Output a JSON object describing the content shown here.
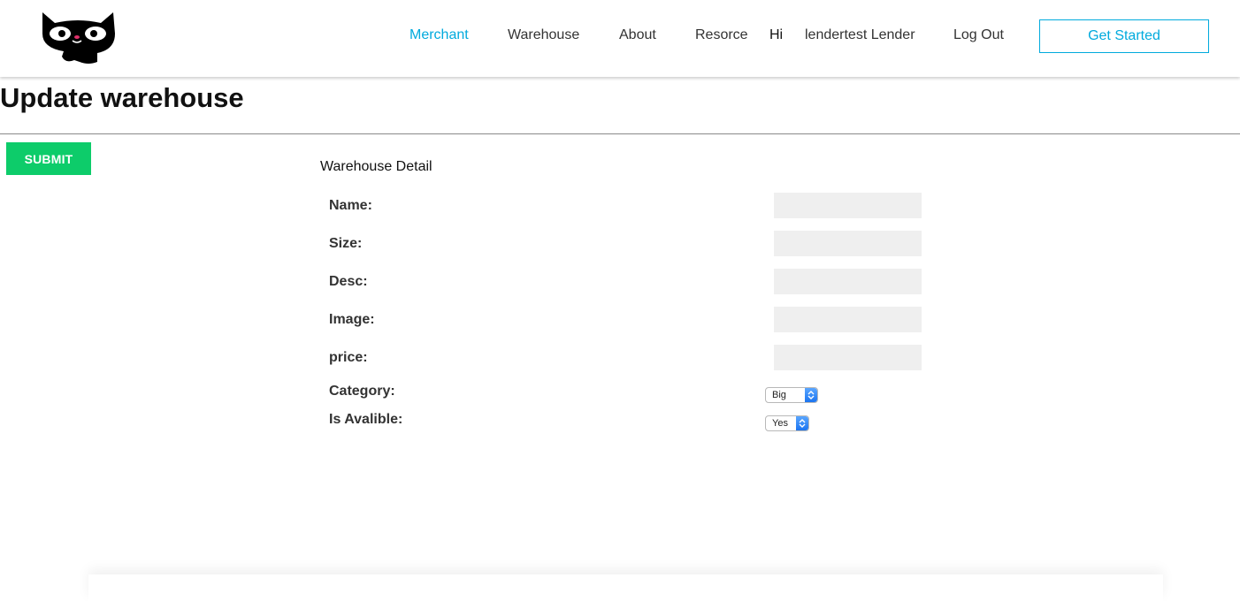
{
  "nav": {
    "items": [
      {
        "label": "Merchant",
        "active": true
      },
      {
        "label": "Warehouse",
        "active": false
      },
      {
        "label": "About",
        "active": false
      },
      {
        "label": "Resorce",
        "active": false
      }
    ],
    "greeting": "Hi",
    "user_name": "lendertest Lender",
    "logout_label": "Log Out",
    "cta_label": "Get Started"
  },
  "page": {
    "title": "Update warehouse",
    "submit_label": "SUBMIT",
    "section_title": "Warehouse Detail"
  },
  "form": {
    "fields": [
      {
        "label": "Name:",
        "value": ""
      },
      {
        "label": "Size:",
        "value": ""
      },
      {
        "label": "Desc:",
        "value": ""
      },
      {
        "label": "Image:",
        "value": ""
      },
      {
        "label": "price:",
        "value": ""
      }
    ],
    "category": {
      "label": "Category:",
      "selected": "Big"
    },
    "availability": {
      "label": "Is Avalible:",
      "selected": "Yes"
    }
  },
  "colors": {
    "accent": "#00aadd",
    "submit": "#0dcc6a",
    "input_bg": "#efefef",
    "text": "#333333"
  },
  "icons": {
    "logo": "cat-face-icon",
    "select_arrow": "chevron-up-down-icon"
  }
}
